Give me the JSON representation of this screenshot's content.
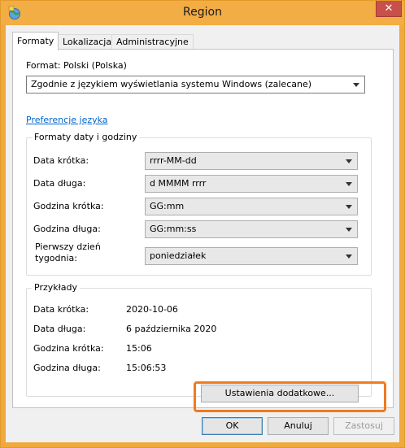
{
  "window": {
    "title": "Region",
    "close_label": "✕"
  },
  "tabs": [
    {
      "label": "Formaty",
      "active": true
    },
    {
      "label": "Lokalizacja",
      "active": false
    },
    {
      "label": "Administracyjne",
      "active": false
    }
  ],
  "format": {
    "label": "Format: Polski (Polska)",
    "value": "Zgodnie z językiem wyświetlania systemu Windows (zalecane)"
  },
  "language_pref_link": "Preferencje języka",
  "date_time_formats": {
    "group_title": "Formaty daty i godziny",
    "rows": [
      {
        "label": "Data krótka:",
        "value": "rrrr-MM-dd"
      },
      {
        "label": "Data długa:",
        "value": "d MMMM rrrr"
      },
      {
        "label": "Godzina krótka:",
        "value": "GG:mm"
      },
      {
        "label": "Godzina długa:",
        "value": "GG:mm:ss"
      },
      {
        "label_line1": "Pierwszy dzień",
        "label_line2": "tygodnia:",
        "value": "poniedziałek"
      }
    ]
  },
  "examples": {
    "group_title": "Przykłady",
    "rows": [
      {
        "label": "Data krótka:",
        "value": "2020-10-06"
      },
      {
        "label": "Data długa:",
        "value": "6 października 2020"
      },
      {
        "label": "Godzina krótka:",
        "value": "15:06"
      },
      {
        "label": "Godzina długa:",
        "value": "15:06:53"
      }
    ]
  },
  "buttons": {
    "additional_settings": "Ustawienia dodatkowe...",
    "ok": "OK",
    "cancel": "Anuluj",
    "apply": "Zastosuj"
  },
  "colors": {
    "accent_frame": "#f0a93e",
    "highlight": "#f07b1e",
    "link": "#0066cc"
  }
}
